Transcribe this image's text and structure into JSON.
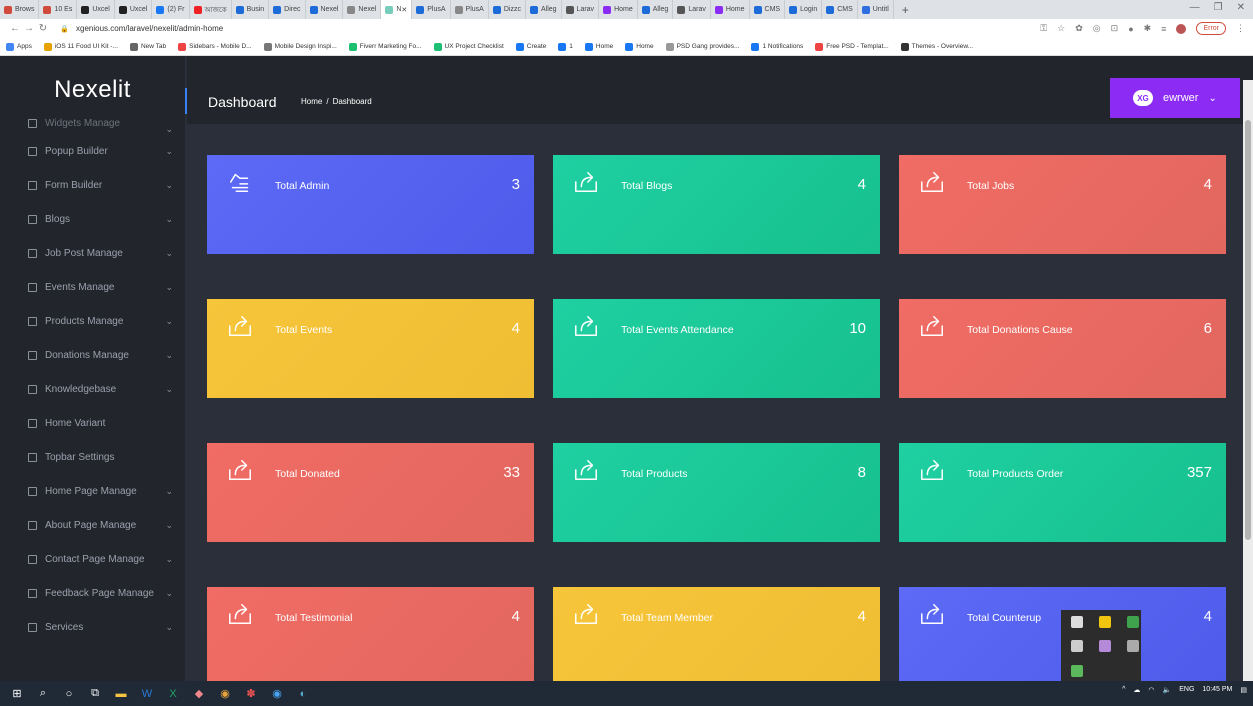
{
  "browser": {
    "tabs": [
      {
        "label": "Brows",
        "color": "#d04b3b"
      },
      {
        "label": "10 Es",
        "color": "#d04b3b"
      },
      {
        "label": "Uxcel",
        "color": "#222"
      },
      {
        "label": "Uxcel",
        "color": "#222"
      },
      {
        "label": "(2) Fr",
        "color": "#1877f2"
      },
      {
        "label": "আজকে",
        "color": "#e22"
      },
      {
        "label": "Busin",
        "color": "#1d6bd8"
      },
      {
        "label": "Direc",
        "color": "#1d6bd8"
      },
      {
        "label": "Nexel",
        "color": "#1d6bd8"
      },
      {
        "label": "Nexel",
        "color": "#888"
      },
      {
        "label": "N",
        "color": "#7cb",
        "active": true
      },
      {
        "label": "PlusA",
        "color": "#1d6bd8"
      },
      {
        "label": "PlusA",
        "color": "#888"
      },
      {
        "label": "Dizzc",
        "color": "#1d6bd8"
      },
      {
        "label": "Alleg",
        "color": "#1d6bd8"
      },
      {
        "label": "Larav",
        "color": "#555"
      },
      {
        "label": "Home",
        "color": "#8b2bf3"
      },
      {
        "label": "Alleg",
        "color": "#1d6bd8"
      },
      {
        "label": "Larav",
        "color": "#555"
      },
      {
        "label": "Home",
        "color": "#8b2bf3"
      },
      {
        "label": "CMS",
        "color": "#1d6bd8"
      },
      {
        "label": "Login",
        "color": "#1d6bd8"
      },
      {
        "label": "CMS",
        "color": "#1d6bd8"
      },
      {
        "label": "Untitl",
        "color": "#2f6fe0"
      }
    ],
    "url": "xgenious.com/laravel/nexelit/admin-home",
    "error_label": "Error",
    "bookmarks": [
      {
        "label": "Apps",
        "color": "#4285f4"
      },
      {
        "label": "iOS 11 Food UI Kit -...",
        "color": "#e8a200"
      },
      {
        "label": "New Tab",
        "color": "#666"
      },
      {
        "label": "Sidebars - Mobile D...",
        "color": "#e44"
      },
      {
        "label": "Mobile Design Inspi...",
        "color": "#777"
      },
      {
        "label": "Fiverr Marketing Fo...",
        "color": "#1dbf73"
      },
      {
        "label": "UX Project Checklist",
        "color": "#1dbf73"
      },
      {
        "label": "Create",
        "color": "#1877f2"
      },
      {
        "label": "1",
        "color": "#1877f2"
      },
      {
        "label": "Home",
        "color": "#1877f2"
      },
      {
        "label": "Home",
        "color": "#1877f2"
      },
      {
        "label": "PSD Gang provides...",
        "color": "#999"
      },
      {
        "label": "1 Notifications",
        "color": "#1877f2"
      },
      {
        "label": "Free PSD - Templat...",
        "color": "#e44"
      },
      {
        "label": "Themes - Overview...",
        "color": "#333"
      }
    ]
  },
  "app": {
    "brand": "Nexelit",
    "page_title": "Dashboard",
    "breadcrumb": {
      "home": "Home",
      "sep": "/",
      "current": "Dashboard"
    },
    "user": {
      "logo_text": "XG",
      "name": "ewrwer"
    }
  },
  "sidebar": {
    "items": [
      {
        "label": "Widgets Manage",
        "has_children": true,
        "partial": true
      },
      {
        "label": "Popup Builder",
        "has_children": true
      },
      {
        "label": "Form Builder",
        "has_children": true
      },
      {
        "label": "Blogs",
        "has_children": true
      },
      {
        "label": "Job Post Manage",
        "has_children": true
      },
      {
        "label": "Events Manage",
        "has_children": true
      },
      {
        "label": "Products Manage",
        "has_children": true
      },
      {
        "label": "Donations Manage",
        "has_children": true
      },
      {
        "label": "Knowledgebase",
        "has_children": true
      },
      {
        "label": "Home Variant",
        "has_children": false
      },
      {
        "label": "Topbar Settings",
        "has_children": false
      },
      {
        "label": "Home Page Manage",
        "has_children": true
      },
      {
        "label": "About Page Manage",
        "has_children": true
      },
      {
        "label": "Contact Page Manage",
        "has_children": true
      },
      {
        "label": "Feedback Page Manage",
        "has_children": true
      },
      {
        "label": "Services",
        "has_children": true
      }
    ]
  },
  "cards": [
    {
      "label": "Total Admin",
      "value": "3",
      "color": "blue",
      "icon": "hand-pointer-icon"
    },
    {
      "label": "Total Blogs",
      "value": "4",
      "color": "green",
      "icon": "share-icon"
    },
    {
      "label": "Total Jobs",
      "value": "4",
      "color": "red",
      "icon": "share-icon"
    },
    {
      "label": "Total Events",
      "value": "4",
      "color": "yellow",
      "icon": "share-icon"
    },
    {
      "label": "Total Events Attendance",
      "value": "10",
      "color": "green",
      "icon": "share-icon"
    },
    {
      "label": "Total Donations Cause",
      "value": "6",
      "color": "red",
      "icon": "share-icon"
    },
    {
      "label": "Total Donated",
      "value": "33",
      "color": "red",
      "icon": "share-icon"
    },
    {
      "label": "Total Products",
      "value": "8",
      "color": "green",
      "icon": "share-icon"
    },
    {
      "label": "Total Products Order",
      "value": "357",
      "color": "green",
      "icon": "share-icon"
    },
    {
      "label": "Total Testimonial",
      "value": "4",
      "color": "red",
      "icon": "share-icon"
    },
    {
      "label": "Total Team Member",
      "value": "4",
      "color": "yellow",
      "icon": "share-icon"
    },
    {
      "label": "Total Counterup",
      "value": "4",
      "color": "blue",
      "icon": "share-icon"
    }
  ],
  "taskbar": {
    "time": "10:45 PM",
    "lang": "ENG"
  }
}
